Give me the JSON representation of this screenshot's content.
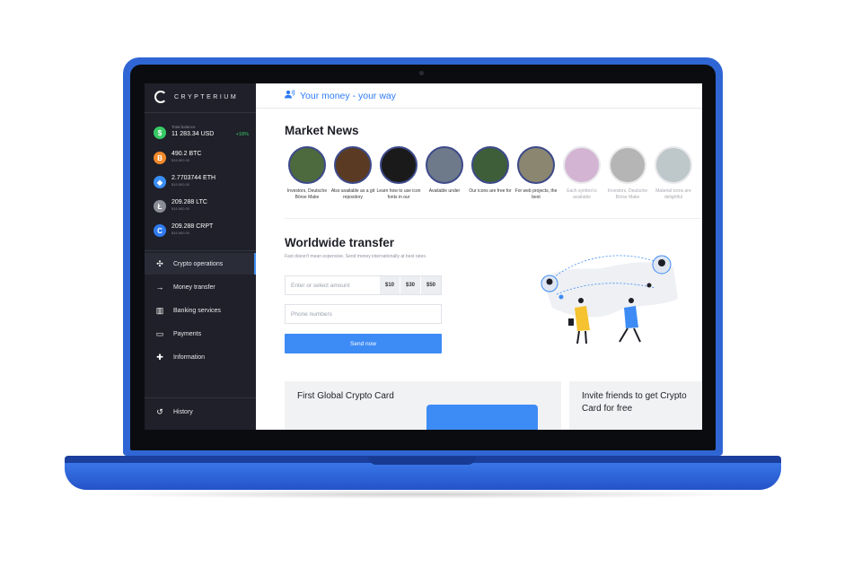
{
  "brand": {
    "name": "CRYPTERIUM"
  },
  "wallet": {
    "total": {
      "label": "Total balance",
      "value": "11 283.34 USD",
      "change": "+18%",
      "icon": "dollar-icon",
      "color": "#37c866"
    },
    "coins": [
      {
        "amount": "490.2 BTC",
        "usd": "$16 800.00",
        "symbol": "B",
        "color": "#f2892a"
      },
      {
        "amount": "2.7703744 ETH",
        "usd": "$16 800.00",
        "symbol": "◆",
        "color": "#3a8df3"
      },
      {
        "amount": "209.288 LTC",
        "usd": "$16 800.00",
        "symbol": "Ł",
        "color": "#8b8d96"
      },
      {
        "amount": "209.288 CRPT",
        "usd": "$16 800.00",
        "symbol": "C",
        "color": "#2f7bf0"
      }
    ]
  },
  "nav": {
    "items": [
      {
        "label": "Crypto operations",
        "icon": "✣",
        "active": true
      },
      {
        "label": "Money transfer",
        "icon": "→"
      },
      {
        "label": "Banking services",
        "icon": "▥"
      },
      {
        "label": "Payments",
        "icon": "▭"
      },
      {
        "label": "Information",
        "icon": "✚"
      }
    ],
    "history": {
      "label": "History",
      "icon": "↺"
    }
  },
  "header": {
    "tagline": "Your money - your way"
  },
  "market_news": {
    "title": "Market News",
    "items": [
      {
        "caption": "Investors, Deutsche Börse Make",
        "color": "#4c6a3e"
      },
      {
        "caption": "Also available as a git repository",
        "color": "#5a3a22"
      },
      {
        "caption": "Learn how to use icon fonts in our",
        "color": "#1a1a1a"
      },
      {
        "caption": "Available under",
        "color": "#6e7a8a"
      },
      {
        "caption": "Our icons are free for",
        "color": "#3e5e3a"
      },
      {
        "caption": "For web projects, the best",
        "color": "#8a8670"
      },
      {
        "caption": "Each symbol is available",
        "color": "#b07ab0",
        "faded": true
      },
      {
        "caption": "Investors, Deutsche Börse Make",
        "color": "#7a7a7a",
        "faded": true
      },
      {
        "caption": "Material icons are delightful",
        "color": "#8a9aa0",
        "faded": true
      }
    ]
  },
  "transfer": {
    "title": "Worldwide transfer",
    "subtitle": "Fast doesn't mean expensive. Send money internationally at best rates.",
    "amount_placeholder": "Enter or select amount",
    "chips": [
      "$10",
      "$30",
      "$50"
    ],
    "phone_placeholder": "Phone numbers",
    "send_label": "Send now"
  },
  "cards": {
    "crypto_card": "First Global Crypto Card",
    "invite": "Invite friends to get Crypto Card for free"
  },
  "colors": {
    "accent": "#3d8bf5",
    "sidebar": "#1f2029",
    "laptop": "#2f66d4"
  }
}
